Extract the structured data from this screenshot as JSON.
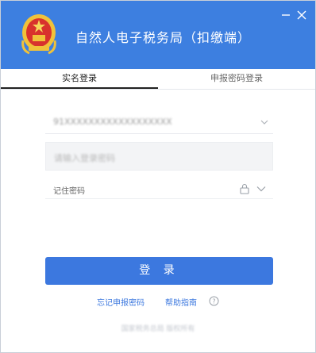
{
  "window": {
    "title": "自然人电子税务局（扣缴端）",
    "minimize_icon": "minimize-icon",
    "close_icon": "close-icon"
  },
  "colors": {
    "brand_blue": "#3d7fe0",
    "button_blue": "#3c78df",
    "link_blue": "#3c78df"
  },
  "tabs": [
    {
      "label": "实名登录",
      "active": true
    },
    {
      "label": "申报密码登录",
      "active": false
    }
  ],
  "form": {
    "account_value": "91XXXXXXXXXXXXXXXXXX",
    "password_placeholder": "请输入登录密码",
    "remember_label": "记住密码"
  },
  "login_button": "登 录",
  "links": {
    "forgot": "忘记申报密码",
    "help": "帮助指南"
  },
  "footer": "国家税务总局 版权所有"
}
